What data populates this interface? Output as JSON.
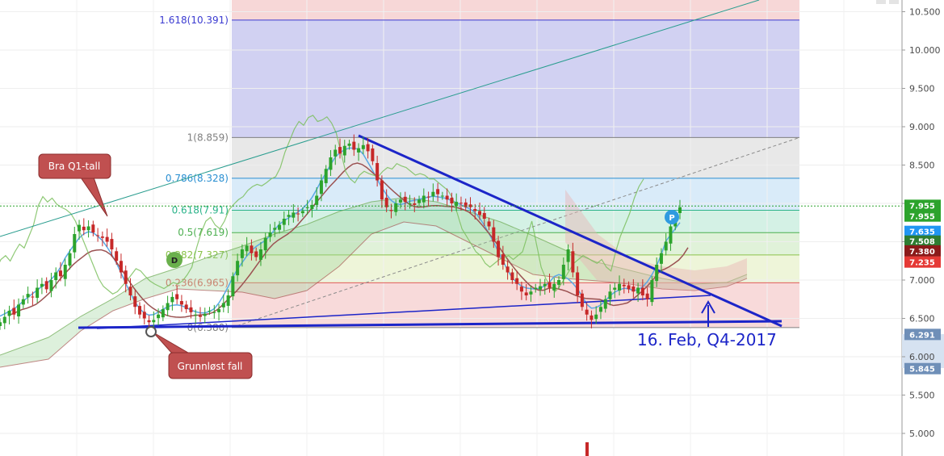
{
  "chart_data": {
    "type": "candlestick",
    "y_axis": {
      "range": [
        4.85,
        10.65
      ],
      "ticks": [
        "10.500",
        "10.000",
        "9.500",
        "9.000",
        "8.500",
        "8.000",
        "7.500",
        "7.000",
        "6.500",
        "6.000",
        "5.500",
        "5.000"
      ],
      "tick_values": [
        10.5,
        10.0,
        9.5,
        9.0,
        8.5,
        8.0,
        7.5,
        7.0,
        6.5,
        6.0,
        5.5,
        5.0
      ],
      "grid": true,
      "position": "right"
    },
    "fib_levels": [
      {
        "ratio": "1.618",
        "price": 10.391,
        "label": "1.618(10.391)",
        "color": "#3b3bd1"
      },
      {
        "ratio": "1",
        "price": 8.859,
        "label": "1(8.859)",
        "color": "#808080"
      },
      {
        "ratio": "0.786",
        "price": 8.328,
        "label": "0.786(8.328)",
        "color": "#2a8fd1"
      },
      {
        "ratio": "0.618",
        "price": 7.91,
        "label": "0.618(7.91)",
        "color": "#2bb38a"
      },
      {
        "ratio": "0.5",
        "price": 7.619,
        "label": "0.5(7.619)",
        "color": "#4caf50"
      },
      {
        "ratio": "0.382",
        "price": 7.327,
        "label": "0.382(7.327)",
        "color": "#8bc34a"
      },
      {
        "ratio": "0.236",
        "price": 6.965,
        "label": "0.236(6.965)",
        "color": "#e05b5b"
      },
      {
        "ratio": "0",
        "price": 6.38,
        "label": "0(6.380)",
        "color": "#808080"
      }
    ],
    "price_tags": [
      {
        "label": "7.955",
        "price": 7.975,
        "color": "#2ca32c"
      },
      {
        "label": "7.955",
        "price": 7.835,
        "color": "#2ca32c"
      },
      {
        "label": "7.635",
        "price": 7.635,
        "color": "#2196f3"
      },
      {
        "label": "7.508",
        "price": 7.508,
        "color": "#2e7d32"
      },
      {
        "label": "7.380",
        "price": 7.38,
        "color": "#8b1a1a"
      },
      {
        "label": "7.235",
        "price": 7.235,
        "color": "#e53935"
      },
      {
        "label": "6.291",
        "price": 6.291,
        "color": "#6f8fb8"
      },
      {
        "label": "5.845",
        "price": 5.845,
        "color": "#6f8fb8"
      }
    ],
    "annotations": {
      "callout_q1": "Bra Q1-tall",
      "callout_fall": "Grunnløst fall",
      "date_note": "16. Feb, Q4-2017",
      "marker_d": "D",
      "marker_p": "P"
    },
    "colors": {
      "up_candle": "#2ca32c",
      "down_candle": "#c62828",
      "trendline": "#1c25c8",
      "channel_line": "#2a9d8f",
      "ichimoku_green": "#6aa84f",
      "ichimoku_red": "#a04040",
      "ichimoku_blue": "#5aa9e6"
    },
    "series_close": [
      6.45,
      6.52,
      6.6,
      6.55,
      6.68,
      6.75,
      6.82,
      6.78,
      6.9,
      6.95,
      6.88,
      7.0,
      7.1,
      7.05,
      7.2,
      7.35,
      7.6,
      7.72,
      7.65,
      7.7,
      7.62,
      7.58,
      7.55,
      7.5,
      7.4,
      7.25,
      7.1,
      6.95,
      6.8,
      6.65,
      6.55,
      6.5,
      6.45,
      6.48,
      6.55,
      6.62,
      6.7,
      6.78,
      6.75,
      6.68,
      6.62,
      6.58,
      6.55,
      6.52,
      6.56,
      6.6,
      6.58,
      6.62,
      6.7,
      6.8,
      7.05,
      7.25,
      7.4,
      7.45,
      7.35,
      7.3,
      7.4,
      7.55,
      7.62,
      7.68,
      7.72,
      7.8,
      7.85,
      7.88,
      7.86,
      7.9,
      7.95,
      7.98,
      8.1,
      8.3,
      8.45,
      8.6,
      8.7,
      8.65,
      8.75,
      8.78,
      8.7,
      8.72,
      8.76,
      8.68,
      8.55,
      8.3,
      8.05,
      7.95,
      7.9,
      8.0,
      8.05,
      8.02,
      8.0,
      7.98,
      8.05,
      8.1,
      8.08,
      8.15,
      8.12,
      8.1,
      8.05,
      8.0,
      8.02,
      8.0,
      7.95,
      7.95,
      7.9,
      7.85,
      7.8,
      7.7,
      7.5,
      7.3,
      7.2,
      7.1,
      7.0,
      6.95,
      6.85,
      6.8,
      6.85,
      6.9,
      6.92,
      6.95,
      6.9,
      6.95,
      7.0,
      7.2,
      7.4,
      7.1,
      6.8,
      6.65,
      6.55,
      6.48,
      6.55,
      6.65,
      6.75,
      6.85,
      6.9,
      6.95,
      6.92,
      6.88,
      6.85,
      6.9,
      6.8,
      6.75,
      7.0,
      7.2,
      7.35,
      7.5,
      7.7,
      7.85,
      7.95
    ]
  }
}
